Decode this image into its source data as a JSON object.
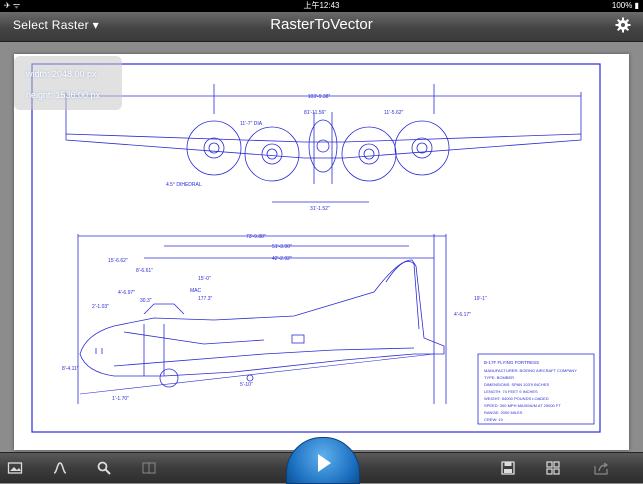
{
  "status_bar": {
    "time": "上午12:43",
    "battery": "100%"
  },
  "nav": {
    "select_label": "Select Raster",
    "title": "RasterToVector"
  },
  "info_overlay": {
    "width_text": "width: 2048.00 px",
    "height_text": "height: 1536.00 px"
  },
  "drawing": {
    "top_span": "103'-9.38\"",
    "dim_a": "81'-11.56\"",
    "dim_b": "11'-5.62\"",
    "dia": "11'-7\" DIA",
    "dihedral": "4.5° DIHEDRAL",
    "bottom_mid": "31'-1.52\"",
    "len_total": "73'-9.88\"",
    "len_b": "51'-3.90\"",
    "len_c": "42'-2.92\"",
    "d1": "15'-6.62\"",
    "d2": "8'-6.61\"",
    "d3": "15'-0\"",
    "d4": "4'-6.97\"",
    "d5": "30.3\"",
    "d6": "2'-1.03\"",
    "mac": "MAC",
    "mac_val": "177.3\"",
    "h1": "8'-4.11\"",
    "h2": "1'-1.70\"",
    "h3": "5'-10\"",
    "h4": "4'-6.17\"",
    "tail_h": "19'-1\"",
    "tb_title": "B-17F FLYING FORTRESS",
    "tb_rows": [
      "MANUFACTURER:  BOEING AIRCRAFT COMPANY",
      "TYPE:  BOMBER",
      "DIMENSIONS:  SPAN 103'9 INCHES",
      "LENGTH:  74 FEET 9 INCHES",
      "WEIGHT:  54000 POUNDS LOADED",
      "SPEED:  300 MPH MAXIMUM AT 25000 FT",
      "RANGE:  2000 MILES",
      "CREW:  10"
    ]
  }
}
